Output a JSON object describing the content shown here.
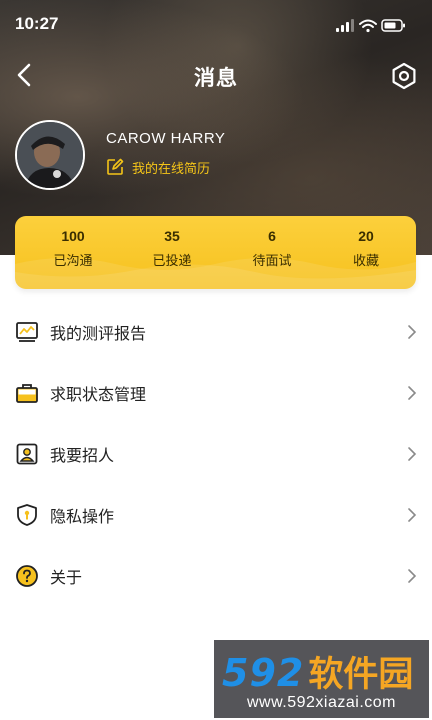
{
  "status_bar": {
    "time": "10:27"
  },
  "header": {
    "title": "消息"
  },
  "profile": {
    "name": "CAROW   HARRY",
    "resume_link": "我的在线简历"
  },
  "stats": [
    {
      "value": "100",
      "label": "已沟通"
    },
    {
      "value": "35",
      "label": "已投递"
    },
    {
      "value": "6",
      "label": "待面试"
    },
    {
      "value": "20",
      "label": "收藏"
    }
  ],
  "menu": [
    {
      "label": "我的测评报告",
      "icon": "evaluation-report-icon"
    },
    {
      "label": "求职状态管理",
      "icon": "briefcase-icon"
    },
    {
      "label": "我要招人",
      "icon": "recruit-icon"
    },
    {
      "label": "隐私操作",
      "icon": "shield-icon"
    },
    {
      "label": "关于",
      "icon": "question-icon"
    }
  ],
  "watermark": {
    "number": "592",
    "name": "软件园",
    "url": "www.592xiazai.com"
  },
  "colors": {
    "accent": "#F6C11E",
    "text": "#222222",
    "watermark_blue": "#1F8FE6",
    "watermark_orange": "#F5A623"
  }
}
